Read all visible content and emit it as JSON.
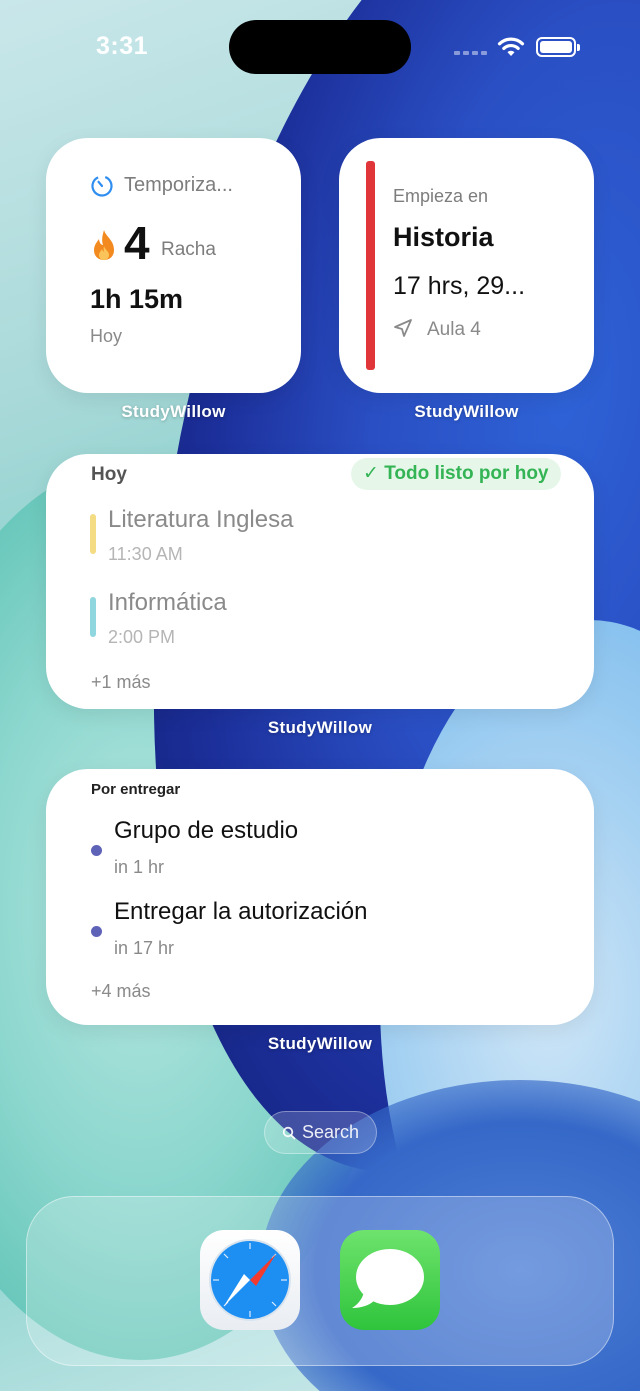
{
  "status_bar": {
    "time": "3:31"
  },
  "widgets": {
    "streak": {
      "app_label": "StudyWillow",
      "timer_label": "Temporiza...",
      "streak_count": "4",
      "streak_label": "Racha",
      "duration": "1h 15m",
      "period": "Hoy"
    },
    "next_class": {
      "app_label": "StudyWillow",
      "starts_label": "Empieza en",
      "subject": "Historia",
      "countdown": "17 hrs, 29...",
      "location": "Aula 4",
      "accent_color": "#e0363a"
    },
    "today": {
      "app_label": "StudyWillow",
      "header": "Hoy",
      "badge": "✓ Todo listo por hoy",
      "items": [
        {
          "title": "Literatura Inglesa",
          "time": "11:30 AM",
          "color": "#f4dc84"
        },
        {
          "title": "Informática",
          "time": "2:00 PM",
          "color": "#8fd6df"
        }
      ],
      "more": "+1 más"
    },
    "due": {
      "app_label": "StudyWillow",
      "header": "Por entregar",
      "items": [
        {
          "title": "Grupo de estudio",
          "due": "in 1 hr"
        },
        {
          "title": "Entregar la autorización",
          "due": "in 17 hr"
        }
      ],
      "more": "+4 más"
    }
  },
  "search": {
    "label": "Search",
    "icon": "search-icon"
  },
  "dock": {
    "apps": [
      {
        "name": "Safari",
        "icon": "safari-icon"
      },
      {
        "name": "Messages",
        "icon": "messages-icon"
      }
    ]
  }
}
